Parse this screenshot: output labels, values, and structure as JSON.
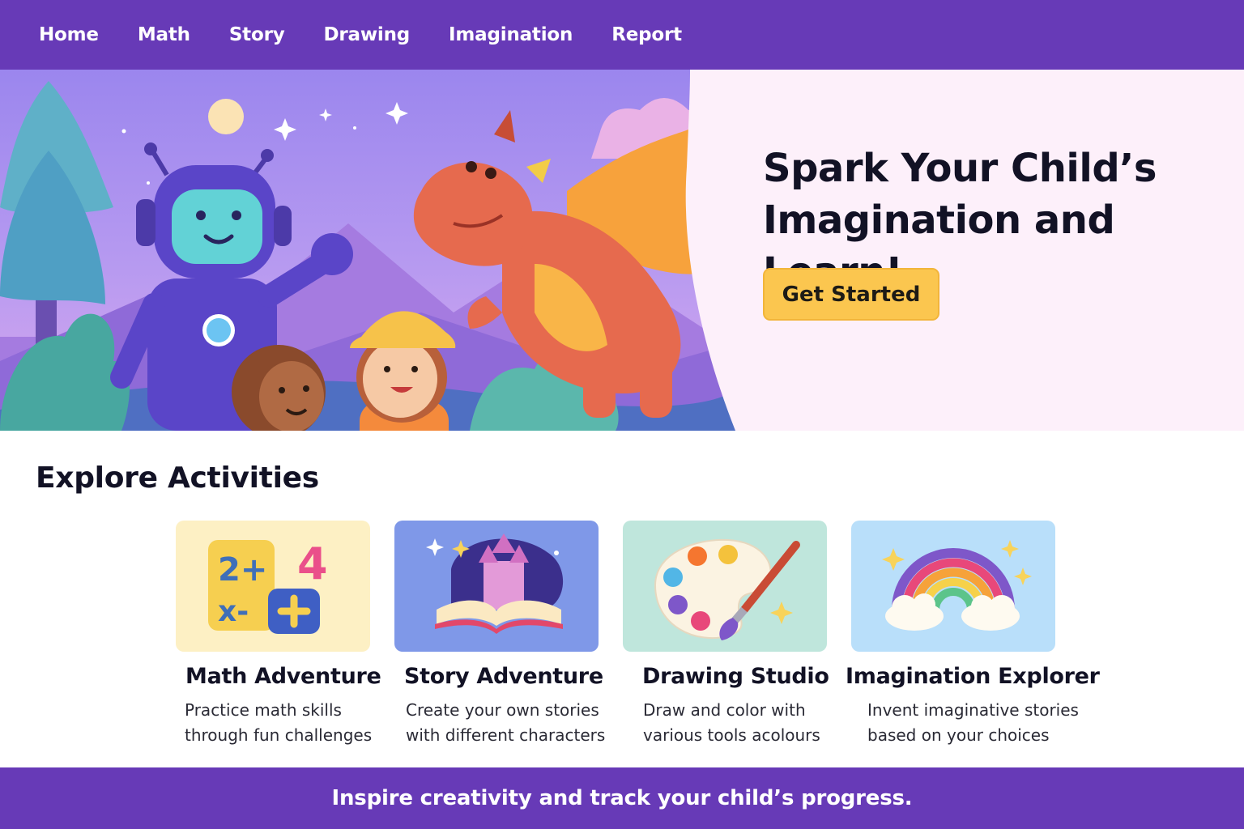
{
  "nav": {
    "items": [
      {
        "label": "Home"
      },
      {
        "label": "Math"
      },
      {
        "label": "Story"
      },
      {
        "label": "Drawing"
      },
      {
        "label": "Imagination"
      },
      {
        "label": "Report"
      }
    ]
  },
  "hero": {
    "title_line1": "Spark Your Child’s",
    "title_line2": "Imagination and Learn!",
    "cta_label": "Get Started",
    "illustration": "robot-kids-dragon-illustration"
  },
  "activities": {
    "title": "Explore Activities",
    "cards": [
      {
        "title": "Math Adventure",
        "desc_line1": "Practice math skills",
        "desc_line2": "through fun challenges",
        "icon": "math-blocks-icon",
        "bg": "#fdf0c4"
      },
      {
        "title": "Story Adventure",
        "desc_line1": "Create your own stories",
        "desc_line2": "with different characters",
        "icon": "storybook-castle-icon",
        "bg": "#7f98e8"
      },
      {
        "title": "Drawing Studio",
        "desc_line1": "Draw and color with",
        "desc_line2": "various tools acolours",
        "icon": "paint-palette-icon",
        "bg": "#bfe6dc"
      },
      {
        "title": "Imagination Explorer",
        "desc_line1": "Invent imaginative stories",
        "desc_line2": "based on your choices",
        "icon": "rainbow-clouds-icon",
        "bg": "#b9dffa"
      }
    ]
  },
  "footer": {
    "text": "Inspire creativity and track your child’s progress."
  },
  "colors": {
    "brand_purple": "#673ab7",
    "cta_yellow": "#fbc64f",
    "hero_panel": "#fdf0fa"
  }
}
